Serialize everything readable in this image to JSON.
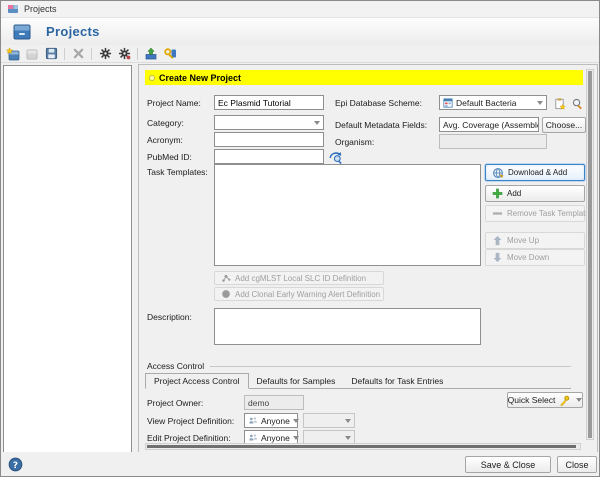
{
  "colors": {
    "banner_bg": "#ffff00",
    "header_text": "#2b66a3",
    "focus_border": "#3d82c4"
  },
  "title_bar": {
    "title": "Projects"
  },
  "header": {
    "title": "Projects"
  },
  "toolbar": {
    "icons": [
      "new-project",
      "duplicate-project",
      "save",
      "delete",
      "settings-gear",
      "tools-gear",
      "import-upload",
      "permissions-key"
    ]
  },
  "banner": {
    "label": "Create New Project"
  },
  "form": {
    "project_name": {
      "label": "Project Name:",
      "value": "Ec Plasmid Tutorial"
    },
    "category": {
      "label": "Category:",
      "value": ""
    },
    "acronym": {
      "label": "Acronym:",
      "value": ""
    },
    "pubmed_id": {
      "label": "PubMed ID:",
      "value": ""
    },
    "epi_database_scheme": {
      "label": "Epi Database Scheme:",
      "value": "Default Bacteria"
    },
    "default_metadata_fields": {
      "label": "Default Metadata Fields:",
      "value": "Avg. Coverage (Assembled), Approximated Ger",
      "choose_button": "Choose..."
    },
    "organism": {
      "label": "Organism:",
      "value": ""
    },
    "task_templates": {
      "label": "Task Templates:"
    },
    "description": {
      "label": "Description:",
      "value": ""
    }
  },
  "task_template_actions": {
    "download_add": "Download & Add",
    "add": "Add",
    "remove": "Remove Task Template",
    "move_up": "Move Up",
    "move_down": "Move Down",
    "add_cgmlst_slc": "Add cgMLST Local SLC ID Definition",
    "add_clonal_alert": "Add Clonal Early Warning Alert Definition"
  },
  "access_control": {
    "group_label": "Access Control",
    "tabs": [
      "Project Access Control",
      "Defaults for Samples",
      "Defaults for Task Entries"
    ],
    "active_tab": "Project Access Control",
    "project_owner": {
      "label": "Project Owner:",
      "value": "demo"
    },
    "view_project_definition": {
      "label": "View Project Definition:",
      "value": "Anyone"
    },
    "edit_project_definition": {
      "label": "Edit Project Definition:",
      "value": "Anyone"
    },
    "quick_select_button": "Quick Select"
  },
  "footer": {
    "save_close_button": "Save & Close",
    "close_button": "Close"
  }
}
